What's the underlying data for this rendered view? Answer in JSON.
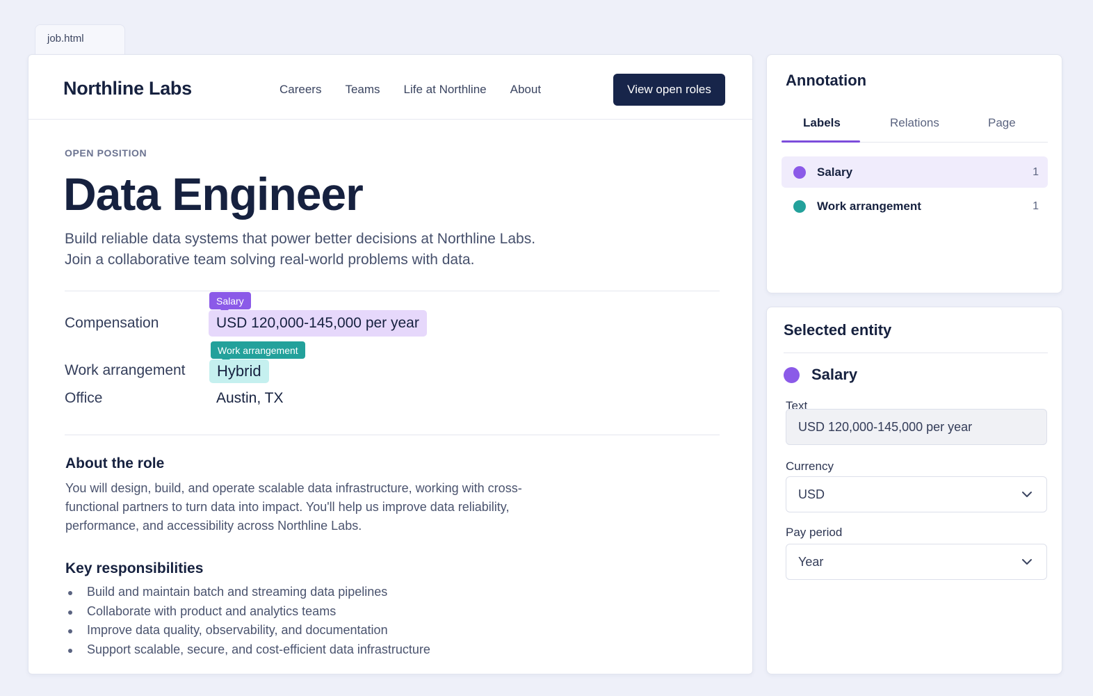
{
  "file_tab": "job.html",
  "site": {
    "brand": "Northline Labs",
    "nav": [
      "Careers",
      "Teams",
      "Life at Northline",
      "About"
    ],
    "cta": "View open roles"
  },
  "job": {
    "eyebrow": "OPEN POSITION",
    "title": "Data Engineer",
    "intro_line1": "Build reliable data systems that power better decisions at Northline Labs.",
    "intro_line2": "Join a collaborative team solving real-world problems with data.",
    "rows": [
      {
        "label": "Compensation",
        "value": "USD 120,000-145,000 per year",
        "tag": "Salary"
      },
      {
        "label": "Work arrangement",
        "value": "Hybrid",
        "tag": "Work arrangement"
      },
      {
        "label": "Office",
        "value": "Austin, TX"
      }
    ],
    "about_heading": "About the role",
    "about_text": "You will design, build, and operate scalable data infrastructure, working with cross-functional partners to turn data into impact. You'll help us improve data reliability, performance, and accessibility across Northline Labs.",
    "resp_heading": "Key responsibilities",
    "responsibilities": [
      "Build and maintain batch and streaming data pipelines",
      "Collaborate with product and analytics teams",
      "Improve data quality, observability, and documentation",
      "Support scalable, secure, and cost-efficient data infrastructure"
    ]
  },
  "annotation": {
    "title": "Annotation",
    "tabs": [
      "Labels",
      "Relations",
      "Page"
    ],
    "active_tab": "Labels",
    "labels": [
      {
        "name": "Salary",
        "count": "1",
        "color": "#8b5ae8",
        "selected": true
      },
      {
        "name": "Work arrangement",
        "count": "1",
        "color": "#23a19b",
        "selected": false
      }
    ]
  },
  "selected_entity": {
    "title": "Selected entity",
    "label": "Salary",
    "color": "#8b5ae8",
    "text_label": "Text",
    "text_value": "USD 120,000-145,000 per year",
    "currency_label": "Currency",
    "currency_value": "USD",
    "period_label": "Pay period",
    "period_value": "Year"
  },
  "icons": {
    "dropdown": "chevron-down-icon"
  }
}
